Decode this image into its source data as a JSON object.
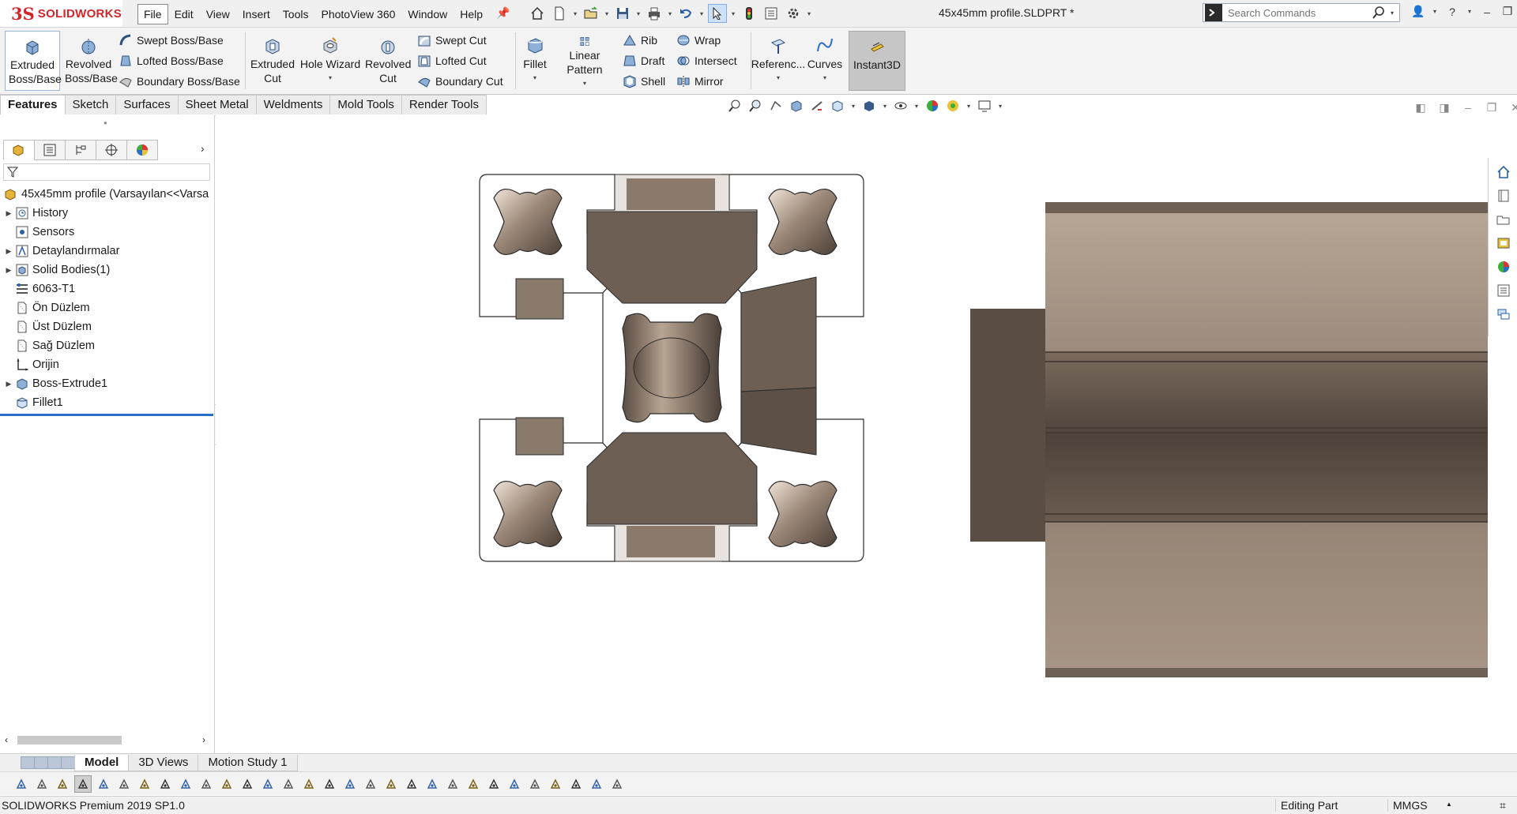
{
  "app": {
    "logo_prefix": "3S",
    "logo_text": "SOLIDWORKS",
    "document_title": "45x45mm profile.SLDPRT *"
  },
  "menu": [
    "File",
    "Edit",
    "View",
    "Insert",
    "Tools",
    "PhotoView 360",
    "Window",
    "Help"
  ],
  "search": {
    "placeholder": "Search Commands"
  },
  "commands": {
    "extruded_boss": "Extruded Boss/Base",
    "revolved_boss": "Revolved Boss/Base",
    "swept_boss": "Swept Boss/Base",
    "lofted_boss": "Lofted Boss/Base",
    "boundary_boss": "Boundary Boss/Base",
    "extruded_cut": "Extruded Cut",
    "hole_wizard": "Hole Wizard",
    "revolved_cut": "Revolved Cut",
    "swept_cut": "Swept Cut",
    "lofted_cut": "Lofted Cut",
    "boundary_cut": "Boundary Cut",
    "fillet": "Fillet",
    "linear_pattern": "Linear Pattern",
    "rib": "Rib",
    "draft": "Draft",
    "shell": "Shell",
    "wrap": "Wrap",
    "intersect": "Intersect",
    "mirror": "Mirror",
    "reference": "Referenc...",
    "curves": "Curves",
    "instant3d": "Instant3D"
  },
  "command_tabs": [
    "Features",
    "Sketch",
    "Surfaces",
    "Sheet Metal",
    "Weldments",
    "Mold Tools",
    "Render Tools"
  ],
  "tree": {
    "root": "45x45mm profile  (Varsayılan<<Varsa",
    "items": [
      {
        "label": "History",
        "icon": "history-icon",
        "expandable": true
      },
      {
        "label": "Sensors",
        "icon": "sensors-icon",
        "expandable": false
      },
      {
        "label": "Detaylandırmalar",
        "icon": "annotations-icon",
        "expandable": true
      },
      {
        "label": "Solid Bodies(1)",
        "icon": "solid-bodies-icon",
        "expandable": true
      },
      {
        "label": "6063-T1",
        "icon": "material-icon",
        "expandable": false
      },
      {
        "label": "Ön Düzlem",
        "icon": "plane-icon",
        "expandable": false
      },
      {
        "label": "Üst Düzlem",
        "icon": "plane-icon",
        "expandable": false
      },
      {
        "label": "Sağ Düzlem",
        "icon": "plane-icon",
        "expandable": false
      },
      {
        "label": "Orijin",
        "icon": "origin-icon",
        "expandable": false
      },
      {
        "label": "Boss-Extrude1",
        "icon": "extrude-feature-icon",
        "expandable": true
      },
      {
        "label": "Fillet1",
        "icon": "fillet-feature-icon",
        "expandable": false
      }
    ]
  },
  "bottom_tabs": [
    "Model",
    "3D Views",
    "Motion Study 1"
  ],
  "status": {
    "product": "SOLIDWORKS Premium 2019 SP1.0",
    "mode": "Editing Part",
    "units": "MMGS"
  },
  "colors": {
    "brand": "#d0262a",
    "selection": "#2b6cc4",
    "part_face": "#a39283",
    "part_dark": "#5c5047"
  }
}
